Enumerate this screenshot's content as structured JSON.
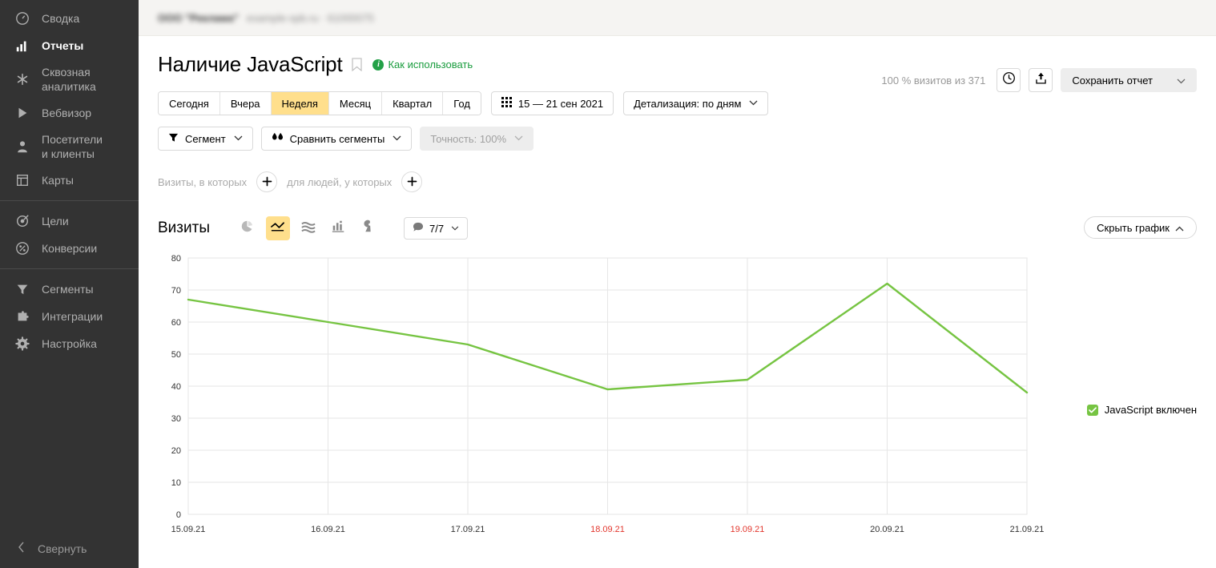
{
  "topbar": {
    "account": "ООО \"Рекламa\"",
    "site": "example-spb.ru · 61000075"
  },
  "sidebar": {
    "items": [
      {
        "label": "Сводка",
        "icon": "gauge-icon",
        "active": false
      },
      {
        "label": "Отчеты",
        "icon": "bar-chart-icon",
        "active": true
      },
      {
        "label": "Сквозная\nаналитика",
        "icon": "asterisk-icon",
        "active": false
      },
      {
        "label": "Вебвизор",
        "icon": "play-icon",
        "active": false
      },
      {
        "label": "Посетители\nи клиенты",
        "icon": "user-icon",
        "active": false
      },
      {
        "label": "Карты",
        "icon": "layout-icon",
        "active": false
      },
      {
        "label": "Цели",
        "icon": "target-icon",
        "active": false
      },
      {
        "label": "Конверсии",
        "icon": "percent-icon",
        "active": false
      },
      {
        "label": "Сегменты",
        "icon": "funnel-icon",
        "active": false
      },
      {
        "label": "Интеграции",
        "icon": "puzzle-icon",
        "active": false
      },
      {
        "label": "Настройка",
        "icon": "gear-icon",
        "active": false
      }
    ],
    "collapse_label": "Свернуть",
    "collapse_icon": "chevron-left-icon"
  },
  "header": {
    "title": "Наличие JavaScript",
    "bookmark_icon": "bookmark-icon",
    "info_icon": "info-circle-icon",
    "howto_label": "Как использовать",
    "visits_count": "100 % визитов из 371",
    "history_icon": "clock-icon",
    "export_icon": "share-export-icon",
    "save_label": "Сохранить отчет",
    "save_caret_icon": "chevron-down-icon"
  },
  "period": {
    "options": [
      "Сегодня",
      "Вчера",
      "Неделя",
      "Месяц",
      "Квартал",
      "Год"
    ],
    "selected": "Неделя",
    "date_range": "15 — 21 сен 2021",
    "calendar_icon": "calendar-grid-icon",
    "detail_label": "Детализация: по дням",
    "detail_caret_icon": "chevron-down-icon"
  },
  "segments": {
    "segment_label": "Сегмент",
    "segment_icon": "funnel-icon",
    "compare_label": "Сравнить сегменты",
    "compare_icon": "compare-drops-icon",
    "accuracy_label": "Точность: 100%",
    "accuracy_disabled": true
  },
  "builder": {
    "visits_label": "Визиты, в которых",
    "people_label": "для людей, у которых",
    "add_icon": "plus-icon"
  },
  "chart_toolbar": {
    "metric_label": "Визиты",
    "types": [
      {
        "name": "pie-chart-icon",
        "active": false
      },
      {
        "name": "line-chart-icon",
        "active": true
      },
      {
        "name": "area-chart-icon",
        "active": false
      },
      {
        "name": "bar-chart-icon",
        "active": false
      },
      {
        "name": "map-pin-icon",
        "active": false
      }
    ],
    "comment_icon": "comment-bubble-icon",
    "comment_count": "7/7",
    "comment_caret_icon": "chevron-down-icon",
    "hide_chart_label": "Скрыть график",
    "hide_chart_icon": "chevron-up-icon"
  },
  "chart_data": {
    "type": "line",
    "title": "Визиты",
    "xlabel": "",
    "ylabel": "",
    "ylim": [
      0,
      80
    ],
    "yticks": [
      0,
      10,
      20,
      30,
      40,
      50,
      60,
      70,
      80
    ],
    "grid": true,
    "legend_position": "right",
    "categories": [
      "15.09.21",
      "16.09.21",
      "17.09.21",
      "18.09.21",
      "19.09.21",
      "20.09.21",
      "21.09.21"
    ],
    "weekend_categories": [
      "18.09.21",
      "19.09.21"
    ],
    "series": [
      {
        "name": "JavaScript включен",
        "color": "#76c442",
        "values": [
          67,
          60,
          53,
          39,
          42,
          72,
          38
        ]
      }
    ]
  },
  "colors": {
    "accent": "#ffdf8c",
    "series_green": "#76c442",
    "link_green": "#1a9c3e",
    "weekend_red": "#e2362d",
    "sidebar_bg": "#333333"
  }
}
